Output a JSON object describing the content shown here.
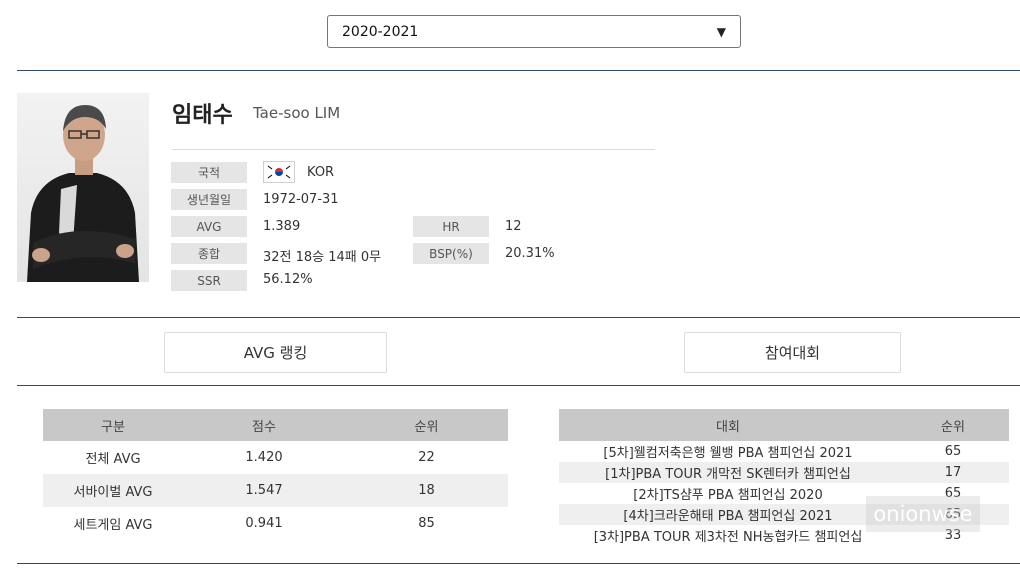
{
  "season_select": {
    "value": "2020-2021"
  },
  "player": {
    "name_kr": "임태수",
    "name_en": "Tae-soo LIM",
    "nationality_label": "국적",
    "nationality_value": "KOR",
    "birth_label": "생년월일",
    "birth_value": "1972-07-31",
    "avg_label": "AVG",
    "avg_value": "1.389",
    "hr_label": "HR",
    "hr_value": "12",
    "total_label": "종합",
    "total_value": "32전 18승 14패 0무",
    "bsp_label": "BSP(%)",
    "bsp_value": "20.31%",
    "ssr_label": "SSR",
    "ssr_value": "56.12%"
  },
  "tabs": {
    "avg_ranking": "AVG 랭킹",
    "tournaments": "참여대회"
  },
  "avg_table": {
    "headers": [
      "구분",
      "점수",
      "순위"
    ],
    "rows": [
      [
        "전체 AVG",
        "1.420",
        "22"
      ],
      [
        "서바이벌 AVG",
        "1.547",
        "18"
      ],
      [
        "세트게임 AVG",
        "0.941",
        "85"
      ]
    ]
  },
  "tournament_table": {
    "headers": [
      "대회",
      "순위"
    ],
    "rows": [
      [
        "[5차]웰컴저축은행 웰뱅 PBA 챔피언십 2021",
        "65"
      ],
      [
        "[1차]PBA TOUR 개막전 SK렌터카 챔피언십",
        "17"
      ],
      [
        "[2차]TS샴푸 PBA 챔피언십 2020",
        "65"
      ],
      [
        "[4차]크라운해태 PBA 챔피언십 2021",
        "65"
      ],
      [
        "[3차]PBA TOUR 제3차전 NH농협카드 챔피언십",
        "33"
      ]
    ]
  },
  "watermark": "onionwse",
  "colors": {
    "divider": "#2f4a6a",
    "header_bg": "#c8c8c8",
    "label_bg": "#e5e5e5"
  }
}
